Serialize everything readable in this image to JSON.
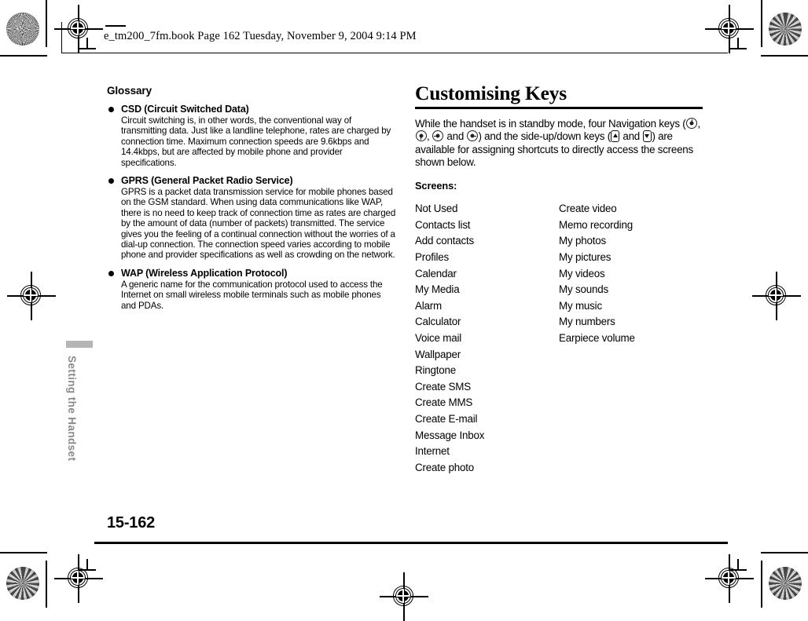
{
  "book_header": {
    "text": "e_tm200_7fm.book  Page 162  Tuesday, November 9, 2004  9:14 PM"
  },
  "side_tab": {
    "label": "Setting the Handset"
  },
  "footer": {
    "page_number": "15-162"
  },
  "left_column": {
    "title": "Glossary",
    "items": [
      {
        "term": "CSD (Circuit Switched Data)",
        "definition": "Circuit switching is, in other words, the conventional way of transmitting data. Just like a landline telephone, rates are charged by connection time. Maximum connection speeds are 9.6kbps and 14.4kbps, but are affected by mobile phone and provider specifications."
      },
      {
        "term": "GPRS (General Packet Radio Service)",
        "definition": "GPRS is a packet data transmission service for mobile phones based on the GSM standard. When using data communications like WAP, there is no need to keep track of connection time as rates are charged by the amount of data (number of packets) transmitted. The service gives you the feeling of a continual connection without the worries of a dial-up connection. The connection speed varies according to mobile phone and provider specifications as well as crowding on the network."
      },
      {
        "term": "WAP (Wireless Application Protocol)",
        "definition": "A generic name for the communication protocol used to access the Internet on small wireless mobile terminals such as mobile phones and PDAs."
      }
    ]
  },
  "right_column": {
    "title": "Customising Keys",
    "intro": {
      "part1": "While the handset is in standby mode, four Navigation keys (",
      "sep1": ", ",
      "sep2": ", ",
      "mid1": " and ",
      "part2": ") and the side-up/down keys (",
      "mid2": " and ",
      "part3": ") are available for assigning shortcuts to directly access the screens shown below.",
      "keys": {
        "nav_up": "nav-key-up-icon",
        "nav_down": "nav-key-down-icon",
        "nav_left": "nav-key-left-icon",
        "nav_right": "nav-key-right-icon",
        "side_up": "side-key-up-icon",
        "side_down": "side-key-down-icon"
      }
    },
    "screens_label": "Screens:",
    "screens_column_1": [
      "Not Used",
      "Contacts list",
      "Add contacts",
      "Profiles",
      "Calendar",
      "My Media",
      "Alarm",
      "Calculator",
      "Voice mail",
      "Wallpaper",
      "Ringtone",
      "Create SMS",
      "Create MMS",
      "Create E-mail",
      "Message Inbox",
      "Internet",
      "Create photo"
    ],
    "screens_column_2": [
      "Create video",
      "Memo recording",
      "My photos",
      "My pictures",
      "My videos",
      "My sounds",
      "My music",
      "My numbers",
      "Earpiece volume"
    ]
  },
  "colors": {
    "text": "#000000",
    "tab_gray": "#8a8a8a",
    "tab_bar_gray": "#b5b5b5"
  }
}
